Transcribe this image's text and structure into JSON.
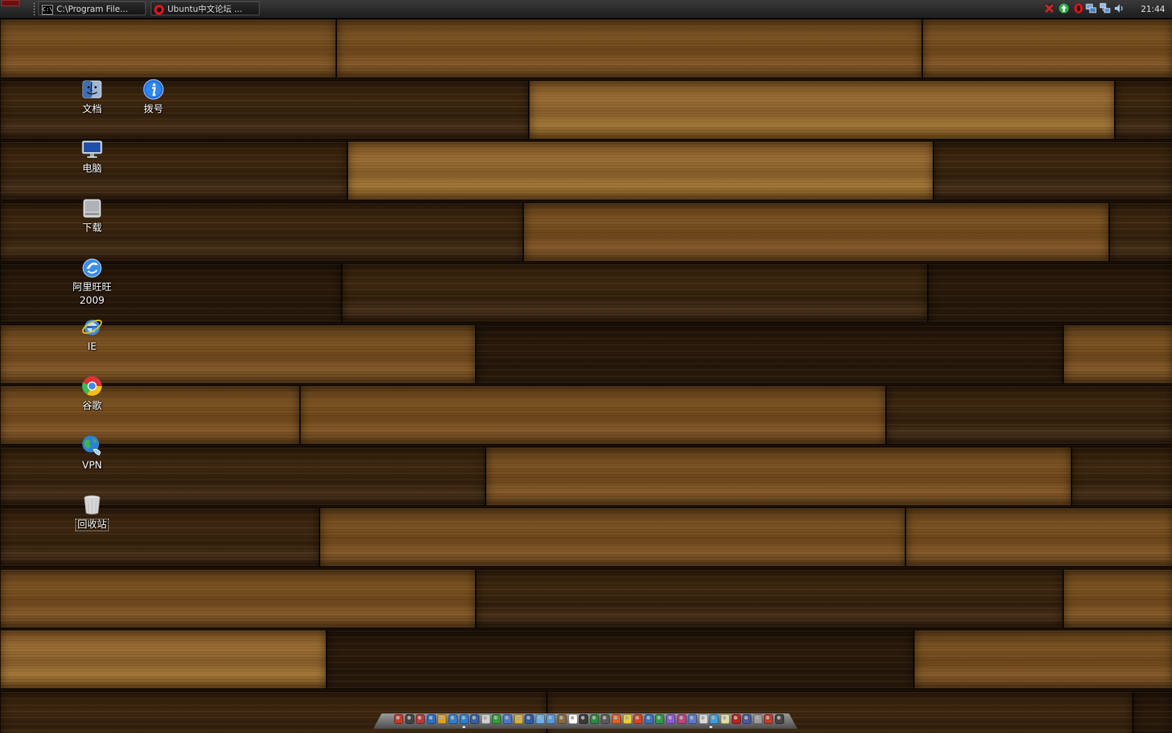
{
  "top_panel": {
    "tasks": [
      {
        "label": "C:\\Program File...",
        "icon": "cmd-icon"
      },
      {
        "label": "Ubuntu中文论坛 ...",
        "icon": "opera-icon"
      }
    ],
    "cmd_icon_text": "C:\\",
    "tray_icons": [
      "close-red-x-icon",
      "update-arrow-icon",
      "opera-red-icon",
      "network-icon",
      "network-computers-icon",
      "sound-icon"
    ],
    "clock": "21:44"
  },
  "desktop_icons": [
    {
      "label": "文档",
      "icon": "finder-icon"
    },
    {
      "label": "拨号",
      "icon": "info-icon"
    },
    {
      "label": "电脑",
      "icon": "monitor-icon"
    },
    {
      "label": "下载",
      "icon": "hard-drive-icon"
    },
    {
      "label": "阿里旺旺\n2009",
      "line1": "阿里旺旺",
      "line2": "2009",
      "icon": "aliwangwang-icon"
    },
    {
      "label": "IE",
      "icon": "internet-explorer-icon"
    },
    {
      "label": "谷歌",
      "icon": "chrome-icon"
    },
    {
      "label": "VPN",
      "icon": "vpn-globe-icon"
    },
    {
      "label": "回收站",
      "icon": "trash-icon",
      "selected": true
    }
  ],
  "dock": {
    "icon_count": 36,
    "colors": [
      "#c63a2a",
      "#444444",
      "#b83a3a",
      "#2a6fc9",
      "#e0a020",
      "#2e7fd0",
      "#2b7ed8",
      "#3a5fa0",
      "#cfcfcf",
      "#2f9e3a",
      "#4a78c8",
      "#d8b040",
      "#2c5ea8",
      "#6ab0e8",
      "#5599dd",
      "#8a6a3a",
      "#ffffff",
      "#3a3a3a",
      "#2a8a3a",
      "#5a5a5a",
      "#e06020",
      "#e8d030",
      "#e04020",
      "#3a70c0",
      "#2a9a4a",
      "#8a5ad8",
      "#c04080",
      "#5a7ad0",
      "#d8d8d8",
      "#3aa0e0",
      "#e0e0a0",
      "#c02020",
      "#4a5aa0",
      "#9a9a9a"
    ]
  },
  "colors": {
    "label_text": "#ffffff",
    "panel_bg": "#1c1c1c",
    "clock_text": "#e6e6e6"
  }
}
